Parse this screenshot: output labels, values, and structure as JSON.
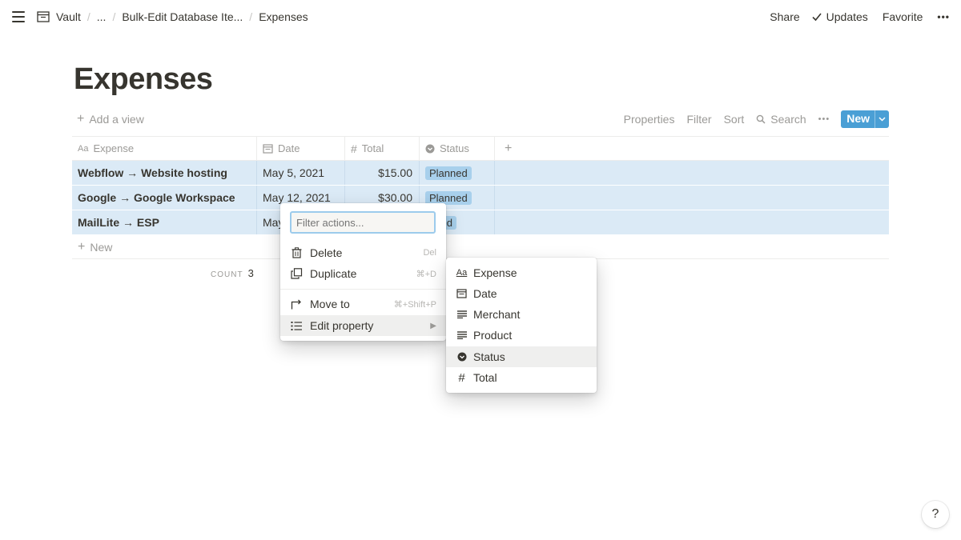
{
  "topbar": {
    "breadcrumbs": [
      "Vault",
      "...",
      "Bulk-Edit Database Ite...",
      "Expenses"
    ],
    "share": "Share",
    "updates": "Updates",
    "favorite": "Favorite",
    "more": "•••"
  },
  "page": {
    "title": "Expenses"
  },
  "viewbar": {
    "add_view": "Add a view",
    "properties": "Properties",
    "filter": "Filter",
    "sort": "Sort",
    "search": "Search",
    "more": "•••",
    "new": "New"
  },
  "table": {
    "headers": [
      "Expense",
      "Date",
      "Total",
      "Status"
    ],
    "rows": [
      {
        "expense": "Webflow → Website hosting",
        "date": "May 5, 2021",
        "total": "$15.00",
        "status": "Planned"
      },
      {
        "expense": "Google → Google Workspace",
        "date": "May 12, 2021",
        "total": "$30.00",
        "status": "Planned"
      },
      {
        "expense": "MailLite → ESP",
        "date": "May",
        "total": "",
        "status": "nned"
      }
    ],
    "new_row": "New",
    "count_label": "COUNT",
    "count_value": "3"
  },
  "context_menu": {
    "filter_placeholder": "Filter actions...",
    "items": [
      {
        "label": "Delete",
        "shortcut": "Del"
      },
      {
        "label": "Duplicate",
        "shortcut": "⌘+D"
      },
      {
        "label": "Move to",
        "shortcut": "⌘+Shift+P"
      },
      {
        "label": "Edit property",
        "shortcut": "▶"
      }
    ]
  },
  "submenu": {
    "items": [
      "Expense",
      "Date",
      "Merchant",
      "Product",
      "Status",
      "Total"
    ],
    "icons": [
      "Aa",
      "calendar-icon",
      "text-icon",
      "text-icon",
      "status-icon",
      "number-icon"
    ],
    "highlighted": "Status"
  },
  "help": "?",
  "colors": {
    "accent": "#4a9fd5",
    "row_selected": "#dbeaf6",
    "tag": "#a8d0ec"
  }
}
